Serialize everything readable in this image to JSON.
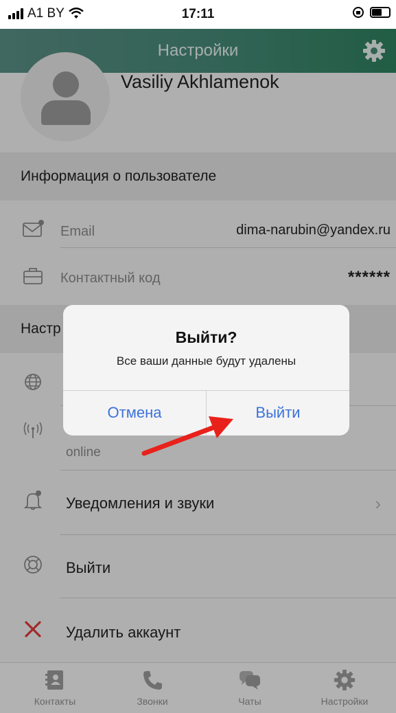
{
  "status_bar": {
    "carrier": "A1 BY",
    "time": "17:11"
  },
  "nav": {
    "title": "Настройки",
    "gear_icon": "gear-icon"
  },
  "profile": {
    "name": "Vasiliy Akhlamenok"
  },
  "user_info": {
    "header": "Информация о пользователе",
    "email_label": "Email",
    "email_value": "dima-narubin@yandex.ru",
    "code_label": "Контактный код",
    "code_value": "******"
  },
  "settings": {
    "header": "Настр",
    "status_value": "online",
    "notifications_label": "Уведомления и звуки",
    "logout_label": "Выйти",
    "delete_label": "Удалить аккаунт"
  },
  "dialog": {
    "title": "Выйти?",
    "message": "Все ваши данные будут удалены",
    "cancel": "Отмена",
    "confirm": "Выйти"
  },
  "tabs": [
    {
      "label": "Контакты",
      "icon": "contacts-icon"
    },
    {
      "label": "Звонки",
      "icon": "phone-icon"
    },
    {
      "label": "Чаты",
      "icon": "chat-icon"
    },
    {
      "label": "Настройки",
      "icon": "gear-icon"
    }
  ],
  "colors": {
    "accent": "#3b72d9",
    "nav": "#468a77",
    "arrow": "#e8221b"
  }
}
